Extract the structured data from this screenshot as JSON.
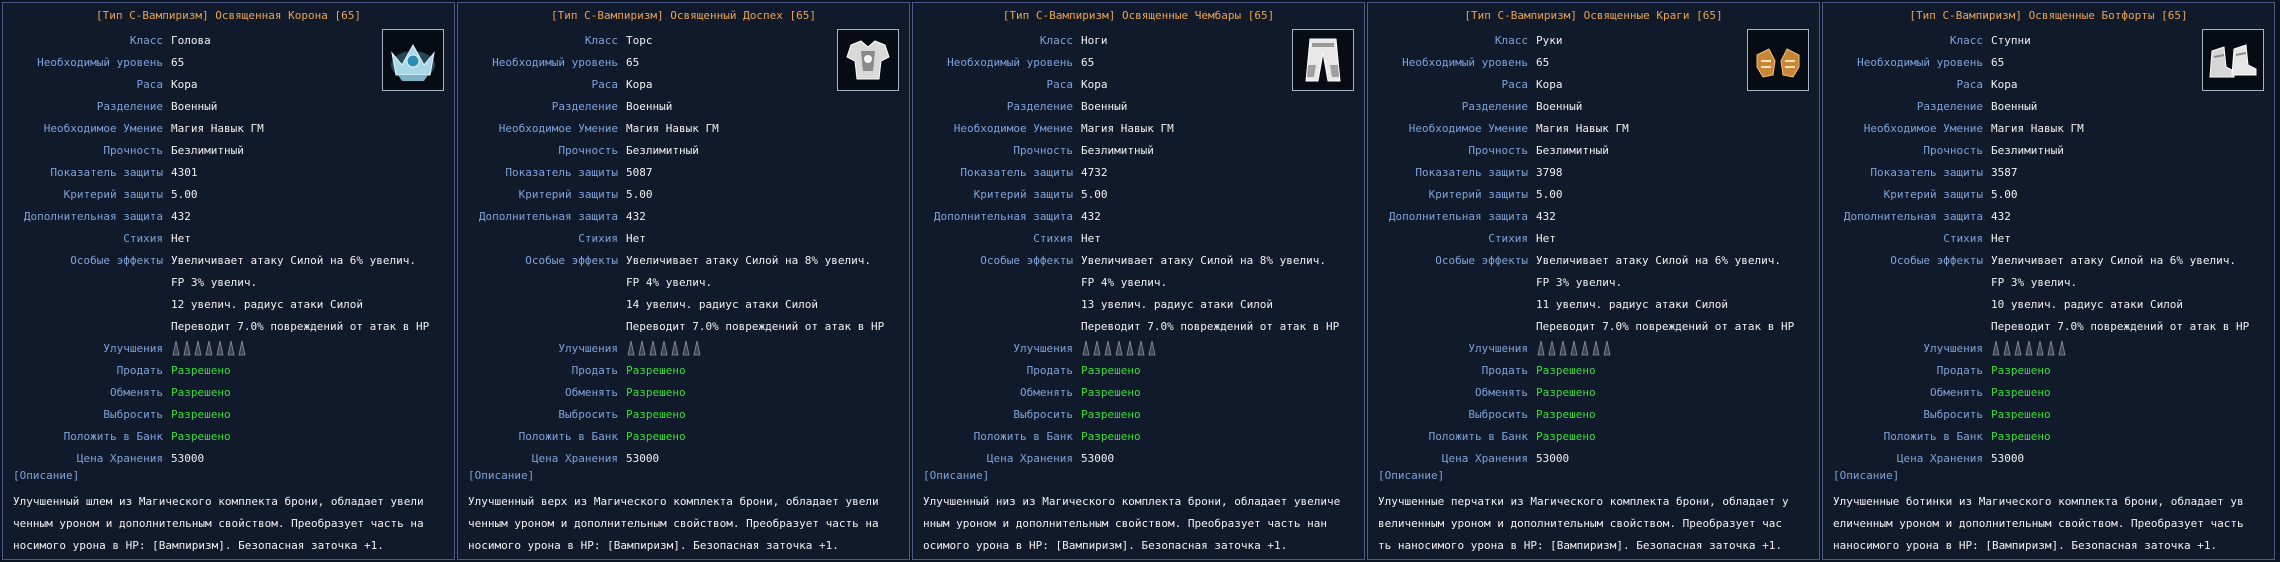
{
  "labels": {
    "class": "Класс",
    "level": "Необходимый уровень",
    "race": "Раса",
    "division": "Разделение",
    "skill": "Необходимое Умение",
    "durability": "Прочность",
    "defense": "Показатель защиты",
    "def_crit": "Критерий защиты",
    "extra_def": "Дополнительная защита",
    "element": "Стихия",
    "special": "Особые эффекты",
    "upgrades": "Улучшения",
    "sell": "Продать",
    "trade": "Обменять",
    "drop": "Выбросить",
    "bank": "Положить в Банк",
    "price": "Цена Хранения",
    "description": "[Описание]"
  },
  "items": [
    {
      "title": "[Тип С-Вампиризм] Освященная Корона [65]",
      "icon": "crown-icon",
      "class": "Голова",
      "level": "65",
      "race": "Кора",
      "division": "Военный",
      "skill": "Магия Навык ГМ",
      "durability": "Безлимитный",
      "defense": "4301",
      "def_crit": "5.00",
      "extra_def": "432",
      "element": "Нет",
      "effect1": "Увеличивает атаку Силой на 6% увелич.",
      "effect2": "FP 3% увелич.",
      "effect3": "12 увелич. радиус атаки Силой",
      "effect4": "Переводит 7.0% повреждений от атак в HP",
      "sell": "Разрешено",
      "trade": "Разрешено",
      "drop": "Разрешено",
      "bank": "Разрешено",
      "price": "53000",
      "description": "Улучшенный шлем из Магического комплекта брони, обладает увели\nченным уроном и дополнительным свойством. Преобразует часть на\nносимого урона в HP: [Вампиризм]. Безопасная заточка +1."
    },
    {
      "title": "[Тип С-Вампиризм] Освященный Доспех [65]",
      "icon": "armor-icon",
      "class": "Торс",
      "level": "65",
      "race": "Кора",
      "division": "Военный",
      "skill": "Магия Навык ГМ",
      "durability": "Безлимитный",
      "defense": "5087",
      "def_crit": "5.00",
      "extra_def": "432",
      "element": "Нет",
      "effect1": "Увеличивает атаку Силой на 8% увелич.",
      "effect2": "FP 4% увелич.",
      "effect3": "14 увелич. радиус атаки Силой",
      "effect4": "Переводит 7.0% повреждений от атак в HP",
      "sell": "Разрешено",
      "trade": "Разрешено",
      "drop": "Разрешено",
      "bank": "Разрешено",
      "price": "53000",
      "description": "Улучшенный верх из Магического комплекта брони, обладает увели\nченным уроном и дополнительным свойством. Преобразует часть на\nносимого урона в HP: [Вампиризм]. Безопасная заточка +1."
    },
    {
      "title": "[Тип С-Вампиризм] Освященные Чембары [65]",
      "icon": "pants-icon",
      "class": "Ноги",
      "level": "65",
      "race": "Кора",
      "division": "Военный",
      "skill": "Магия Навык ГМ",
      "durability": "Безлимитный",
      "defense": "4732",
      "def_crit": "5.00",
      "extra_def": "432",
      "element": "Нет",
      "effect1": "Увеличивает атаку Силой на 8% увелич.",
      "effect2": "FP 4% увелич.",
      "effect3": "13 увелич. радиус атаки Силой",
      "effect4": "Переводит 7.0% повреждений от атак в HP",
      "sell": "Разрешено",
      "trade": "Разрешено",
      "drop": "Разрешено",
      "bank": "Разрешено",
      "price": "53000",
      "description": "Улучшенный низ из Магического комплекта брони, обладает увеличе\nнным уроном и дополнительным свойством. Преобразует часть нан\nосимого урона в HP: [Вампиризм]. Безопасная заточка +1."
    },
    {
      "title": "[Тип С-Вампиризм] Освященные Краги [65]",
      "icon": "gloves-icon",
      "class": "Руки",
      "level": "65",
      "race": "Кора",
      "division": "Военный",
      "skill": "Магия Навык ГМ",
      "durability": "Безлимитный",
      "defense": "3798",
      "def_crit": "5.00",
      "extra_def": "432",
      "element": "Нет",
      "effect1": "Увеличивает атаку Силой на 6% увелич.",
      "effect2": "FP 3% увелич.",
      "effect3": "11 увелич. радиус атаки Силой",
      "effect4": "Переводит 7.0% повреждений от атак в HP",
      "sell": "Разрешено",
      "trade": "Разрешено",
      "drop": "Разрешено",
      "bank": "Разрешено",
      "price": "53000",
      "description": "Улучшенные перчатки из Магического комплекта брони, обладает у\nвеличенным уроном и дополнительным свойством. Преобразует час\nть наносимого урона в HP: [Вампиризм]. Безопасная заточка +1."
    },
    {
      "title": "[Тип С-Вампиризм] Освященные Ботфорты [65]",
      "icon": "boots-icon",
      "class": "Ступни",
      "level": "65",
      "race": "Кора",
      "division": "Военный",
      "skill": "Магия Навык ГМ",
      "durability": "Безлимитный",
      "defense": "3587",
      "def_crit": "5.00",
      "extra_def": "432",
      "element": "Нет",
      "effect1": "Увеличивает атаку Силой на 6% увелич.",
      "effect2": "FP 3% увелич.",
      "effect3": "10 увелич. радиус атаки Силой",
      "effect4": "Переводит 7.0% повреждений от атак в HP",
      "sell": "Разрешено",
      "trade": "Разрешено",
      "drop": "Разрешено",
      "bank": "Разрешено",
      "price": "53000",
      "description": "Улучшенные ботинки из Магического комплекта брони, обладает ув\nеличенным уроном и дополнительным свойством. Преобразует часть\n наносимого урона в HP: [Вампиризм]. Безопасная заточка +1."
    }
  ],
  "colors": {
    "title": "#e7a454",
    "label": "#7ea2d9",
    "value": "#f1f1f1",
    "allowed": "#39dd39",
    "border": "#4b5a86"
  }
}
